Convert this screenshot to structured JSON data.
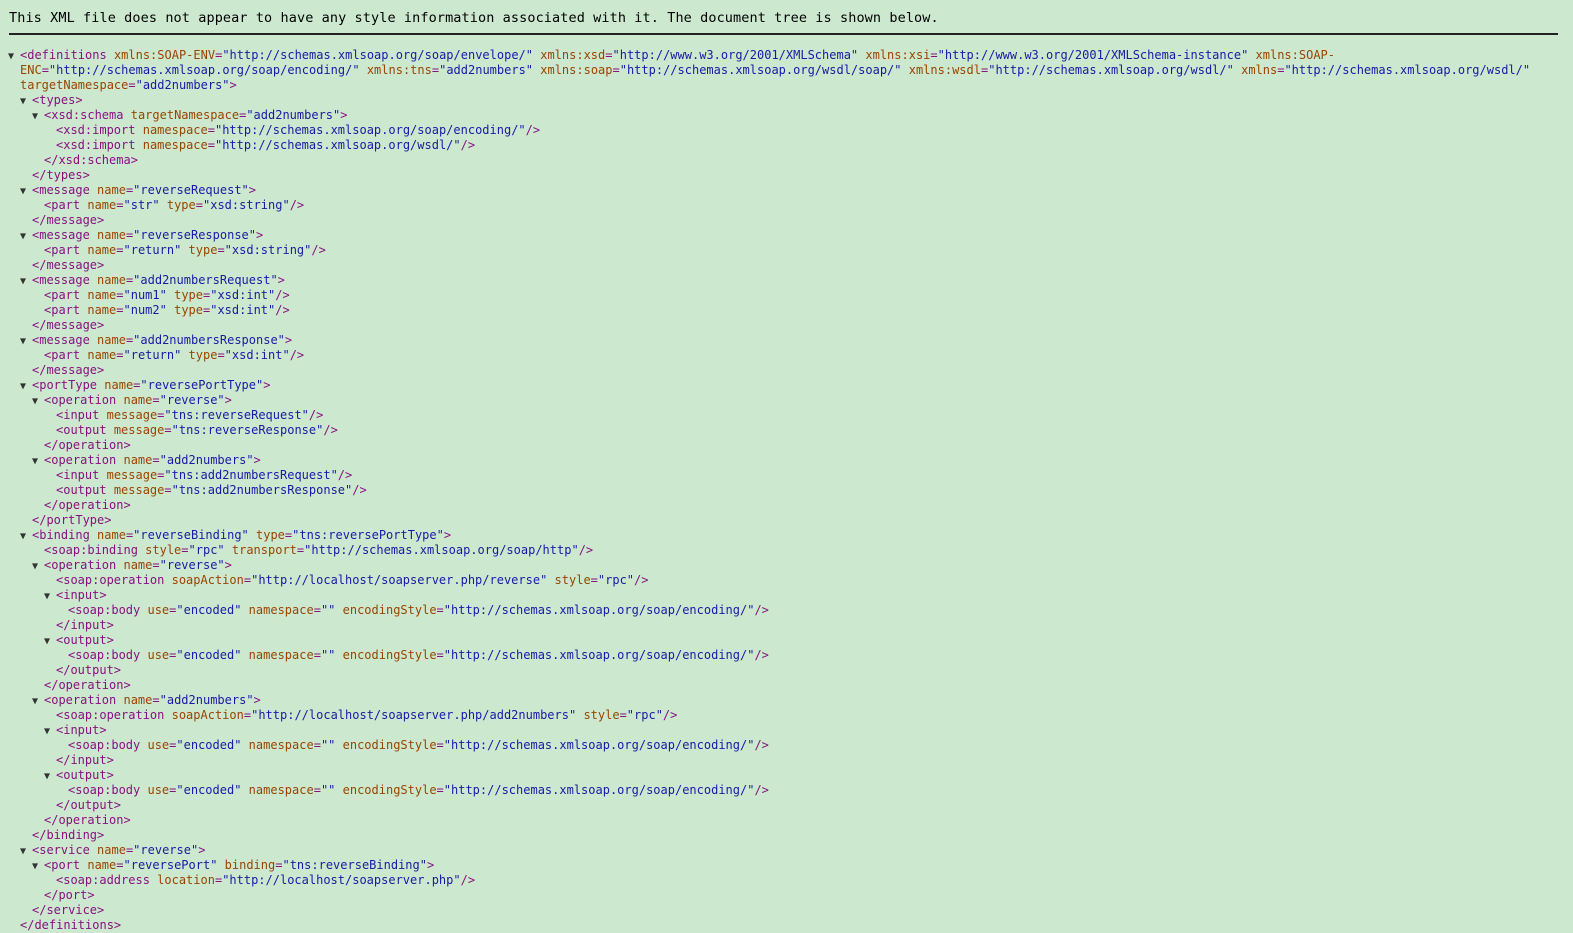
{
  "notice": "This XML file does not appear to have any style information associated with it. The document tree is shown below.",
  "colors": {
    "background": "#cce8cf",
    "tag": "#881280",
    "attr": "#994500",
    "value": "#1a1aa6"
  },
  "lines": [
    {
      "depth": 0,
      "t": 1,
      "open": "definitions",
      "attrs": [
        [
          "xmlns:SOAP-ENV",
          "http://schemas.xmlsoap.org/soap/envelope/"
        ],
        [
          "xmlns:xsd",
          "http://www.w3.org/2001/XMLSchema"
        ],
        [
          "xmlns:xsi",
          "http://www.w3.org/2001/XMLSchema-instance"
        ]
      ],
      "tail": " xmlns:SOAP-"
    },
    {
      "depth": 0,
      "raw": [
        [
          "a",
          "ENC"
        ],
        [
          "p",
          "="
        ],
        [
          "v",
          "\"http://schemas.xmlsoap.org/soap/encoding/\""
        ],
        [
          "p",
          " "
        ],
        [
          "a",
          "xmlns:tns"
        ],
        [
          "p",
          "="
        ],
        [
          "v",
          "\"add2numbers\""
        ],
        [
          "p",
          " "
        ],
        [
          "a",
          "xmlns:soap"
        ],
        [
          "p",
          "="
        ],
        [
          "v",
          "\"http://schemas.xmlsoap.org/wsdl/soap/\""
        ],
        [
          "p",
          " "
        ],
        [
          "a",
          "xmlns:wsdl"
        ],
        [
          "p",
          "="
        ],
        [
          "v",
          "\"http://schemas.xmlsoap.org/wsdl/\""
        ],
        [
          "p",
          " "
        ],
        [
          "a",
          "xmlns"
        ],
        [
          "p",
          "="
        ],
        [
          "v",
          "\"http://schemas.xmlsoap.org/wsdl/\""
        ]
      ]
    },
    {
      "depth": 0,
      "raw": [
        [
          "a",
          "targetNamespace"
        ],
        [
          "p",
          "="
        ],
        [
          "v",
          "\"add2numbers\""
        ],
        [
          "t",
          ">"
        ]
      ]
    },
    {
      "depth": 1,
      "t": 1,
      "open": "types",
      "attrs": []
    },
    {
      "depth": 2,
      "t": 1,
      "open": "xsd:schema",
      "attrs": [
        [
          "targetNamespace",
          "add2numbers"
        ]
      ]
    },
    {
      "depth": 3,
      "self": "xsd:import",
      "attrs": [
        [
          "namespace",
          "http://schemas.xmlsoap.org/soap/encoding/"
        ]
      ]
    },
    {
      "depth": 3,
      "self": "xsd:import",
      "attrs": [
        [
          "namespace",
          "http://schemas.xmlsoap.org/wsdl/"
        ]
      ]
    },
    {
      "depth": 2,
      "close": "xsd:schema"
    },
    {
      "depth": 1,
      "close": "types"
    },
    {
      "depth": 1,
      "t": 1,
      "open": "message",
      "attrs": [
        [
          "name",
          "reverseRequest"
        ]
      ]
    },
    {
      "depth": 2,
      "self": "part",
      "attrs": [
        [
          "name",
          "str"
        ],
        [
          "type",
          "xsd:string"
        ]
      ]
    },
    {
      "depth": 1,
      "close": "message"
    },
    {
      "depth": 1,
      "t": 1,
      "open": "message",
      "attrs": [
        [
          "name",
          "reverseResponse"
        ]
      ]
    },
    {
      "depth": 2,
      "self": "part",
      "attrs": [
        [
          "name",
          "return"
        ],
        [
          "type",
          "xsd:string"
        ]
      ]
    },
    {
      "depth": 1,
      "close": "message"
    },
    {
      "depth": 1,
      "t": 1,
      "open": "message",
      "attrs": [
        [
          "name",
          "add2numbersRequest"
        ]
      ]
    },
    {
      "depth": 2,
      "self": "part",
      "attrs": [
        [
          "name",
          "num1"
        ],
        [
          "type",
          "xsd:int"
        ]
      ]
    },
    {
      "depth": 2,
      "self": "part",
      "attrs": [
        [
          "name",
          "num2"
        ],
        [
          "type",
          "xsd:int"
        ]
      ]
    },
    {
      "depth": 1,
      "close": "message"
    },
    {
      "depth": 1,
      "t": 1,
      "open": "message",
      "attrs": [
        [
          "name",
          "add2numbersResponse"
        ]
      ]
    },
    {
      "depth": 2,
      "self": "part",
      "attrs": [
        [
          "name",
          "return"
        ],
        [
          "type",
          "xsd:int"
        ]
      ]
    },
    {
      "depth": 1,
      "close": "message"
    },
    {
      "depth": 1,
      "t": 1,
      "open": "portType",
      "attrs": [
        [
          "name",
          "reversePortType"
        ]
      ]
    },
    {
      "depth": 2,
      "t": 1,
      "open": "operation",
      "attrs": [
        [
          "name",
          "reverse"
        ]
      ]
    },
    {
      "depth": 3,
      "self": "input",
      "attrs": [
        [
          "message",
          "tns:reverseRequest"
        ]
      ]
    },
    {
      "depth": 3,
      "self": "output",
      "attrs": [
        [
          "message",
          "tns:reverseResponse"
        ]
      ]
    },
    {
      "depth": 2,
      "close": "operation"
    },
    {
      "depth": 2,
      "t": 1,
      "open": "operation",
      "attrs": [
        [
          "name",
          "add2numbers"
        ]
      ]
    },
    {
      "depth": 3,
      "self": "input",
      "attrs": [
        [
          "message",
          "tns:add2numbersRequest"
        ]
      ]
    },
    {
      "depth": 3,
      "self": "output",
      "attrs": [
        [
          "message",
          "tns:add2numbersResponse"
        ]
      ]
    },
    {
      "depth": 2,
      "close": "operation"
    },
    {
      "depth": 1,
      "close": "portType"
    },
    {
      "depth": 1,
      "t": 1,
      "open": "binding",
      "attrs": [
        [
          "name",
          "reverseBinding"
        ],
        [
          "type",
          "tns:reversePortType"
        ]
      ]
    },
    {
      "depth": 2,
      "self": "soap:binding",
      "attrs": [
        [
          "style",
          "rpc"
        ],
        [
          "transport",
          "http://schemas.xmlsoap.org/soap/http"
        ]
      ]
    },
    {
      "depth": 2,
      "t": 1,
      "open": "operation",
      "attrs": [
        [
          "name",
          "reverse"
        ]
      ]
    },
    {
      "depth": 3,
      "self": "soap:operation",
      "attrs": [
        [
          "soapAction",
          "http://localhost/soapserver.php/reverse"
        ],
        [
          "style",
          "rpc"
        ]
      ]
    },
    {
      "depth": 3,
      "t": 1,
      "open": "input",
      "attrs": []
    },
    {
      "depth": 4,
      "self": "soap:body",
      "attrs": [
        [
          "use",
          "encoded"
        ],
        [
          "namespace",
          ""
        ],
        [
          "encodingStyle",
          "http://schemas.xmlsoap.org/soap/encoding/"
        ]
      ]
    },
    {
      "depth": 3,
      "close": "input"
    },
    {
      "depth": 3,
      "t": 1,
      "open": "output",
      "attrs": []
    },
    {
      "depth": 4,
      "self": "soap:body",
      "attrs": [
        [
          "use",
          "encoded"
        ],
        [
          "namespace",
          ""
        ],
        [
          "encodingStyle",
          "http://schemas.xmlsoap.org/soap/encoding/"
        ]
      ]
    },
    {
      "depth": 3,
      "close": "output"
    },
    {
      "depth": 2,
      "close": "operation"
    },
    {
      "depth": 2,
      "t": 1,
      "open": "operation",
      "attrs": [
        [
          "name",
          "add2numbers"
        ]
      ]
    },
    {
      "depth": 3,
      "self": "soap:operation",
      "attrs": [
        [
          "soapAction",
          "http://localhost/soapserver.php/add2numbers"
        ],
        [
          "style",
          "rpc"
        ]
      ]
    },
    {
      "depth": 3,
      "t": 1,
      "open": "input",
      "attrs": []
    },
    {
      "depth": 4,
      "self": "soap:body",
      "attrs": [
        [
          "use",
          "encoded"
        ],
        [
          "namespace",
          ""
        ],
        [
          "encodingStyle",
          "http://schemas.xmlsoap.org/soap/encoding/"
        ]
      ]
    },
    {
      "depth": 3,
      "close": "input"
    },
    {
      "depth": 3,
      "t": 1,
      "open": "output",
      "attrs": []
    },
    {
      "depth": 4,
      "self": "soap:body",
      "attrs": [
        [
          "use",
          "encoded"
        ],
        [
          "namespace",
          ""
        ],
        [
          "encodingStyle",
          "http://schemas.xmlsoap.org/soap/encoding/"
        ]
      ]
    },
    {
      "depth": 3,
      "close": "output"
    },
    {
      "depth": 2,
      "close": "operation"
    },
    {
      "depth": 1,
      "close": "binding"
    },
    {
      "depth": 1,
      "t": 1,
      "open": "service",
      "attrs": [
        [
          "name",
          "reverse"
        ]
      ]
    },
    {
      "depth": 2,
      "t": 1,
      "open": "port",
      "attrs": [
        [
          "name",
          "reversePort"
        ],
        [
          "binding",
          "tns:reverseBinding"
        ]
      ]
    },
    {
      "depth": 3,
      "self": "soap:address",
      "attrs": [
        [
          "location",
          "http://localhost/soapserver.php"
        ]
      ]
    },
    {
      "depth": 2,
      "close": "port"
    },
    {
      "depth": 1,
      "close": "service"
    },
    {
      "depth": 0,
      "close": "definitions"
    }
  ]
}
